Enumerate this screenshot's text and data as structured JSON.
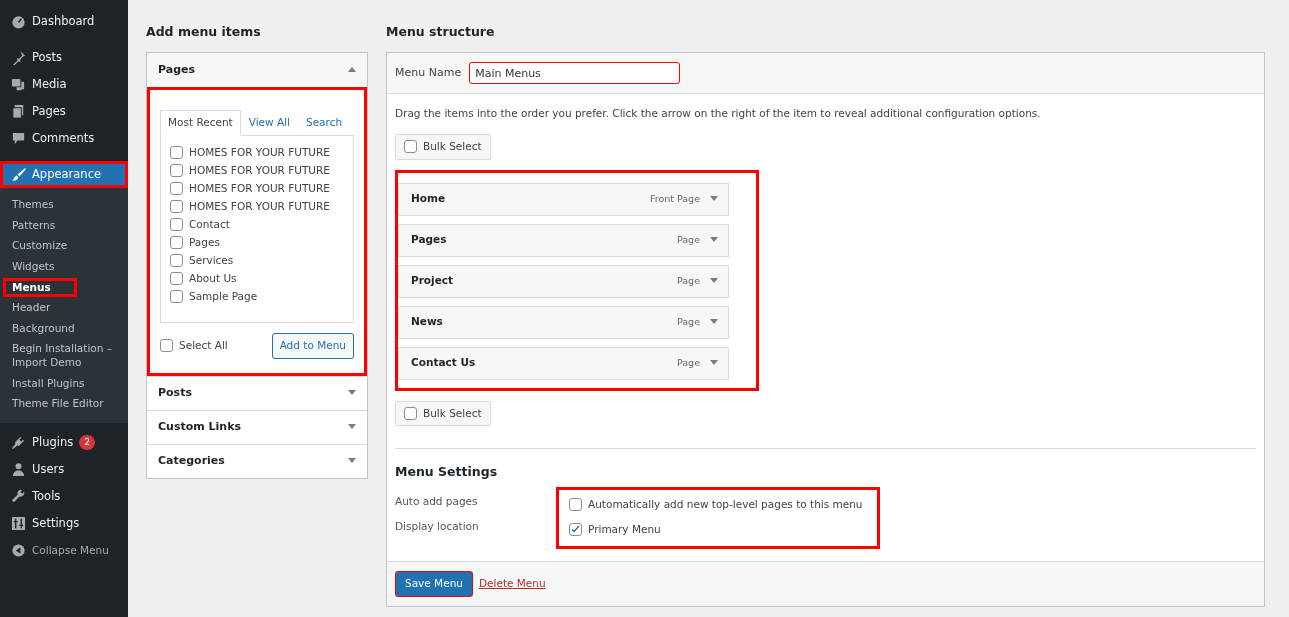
{
  "sidebar": {
    "items": [
      {
        "label": "Dashboard",
        "selected": false,
        "highlighted": false
      },
      {
        "label": "Posts",
        "selected": false,
        "highlighted": false
      },
      {
        "label": "Media",
        "selected": false,
        "highlighted": false
      },
      {
        "label": "Pages",
        "selected": false,
        "highlighted": false
      },
      {
        "label": "Comments",
        "selected": false,
        "highlighted": false
      },
      {
        "label": "Appearance",
        "selected": true,
        "highlighted": true,
        "children": [
          {
            "label": "Themes",
            "selected": false,
            "highlighted": false
          },
          {
            "label": "Patterns",
            "selected": false,
            "highlighted": false
          },
          {
            "label": "Customize",
            "selected": false,
            "highlighted": false
          },
          {
            "label": "Widgets",
            "selected": false,
            "highlighted": false
          },
          {
            "label": "Menus",
            "selected": true,
            "highlighted": true
          },
          {
            "label": "Header",
            "selected": false,
            "highlighted": false
          },
          {
            "label": "Background",
            "selected": false,
            "highlighted": false
          },
          {
            "label": "Begin Installation – Import Demo",
            "selected": false,
            "highlighted": false
          },
          {
            "label": "Install Plugins",
            "selected": false,
            "highlighted": false
          },
          {
            "label": "Theme File Editor",
            "selected": false,
            "highlighted": false
          }
        ]
      },
      {
        "label": "Plugins",
        "selected": false,
        "highlighted": false,
        "badge": "2"
      },
      {
        "label": "Users",
        "selected": false,
        "highlighted": false
      },
      {
        "label": "Tools",
        "selected": false,
        "highlighted": false
      },
      {
        "label": "Settings",
        "selected": false,
        "highlighted": false
      },
      {
        "label": "Collapse Menu",
        "selected": false,
        "highlighted": false
      }
    ]
  },
  "add_menu_items": {
    "heading": "Add menu items",
    "panels": [
      {
        "title": "Pages",
        "expanded": true,
        "highlighted": true,
        "tabs": [
          {
            "label": "Most Recent",
            "selected": true
          },
          {
            "label": "View All",
            "selected": false
          },
          {
            "label": "Search",
            "selected": false
          }
        ],
        "items": [
          {
            "label": "HOMES FOR YOUR FUTURE",
            "checked": false
          },
          {
            "label": "HOMES FOR YOUR FUTURE",
            "checked": false
          },
          {
            "label": "HOMES FOR YOUR FUTURE",
            "checked": false
          },
          {
            "label": "HOMES FOR YOUR FUTURE",
            "checked": false
          },
          {
            "label": "Contact",
            "checked": false
          },
          {
            "label": "Pages",
            "checked": false
          },
          {
            "label": "Services",
            "checked": false
          },
          {
            "label": "About Us",
            "checked": false
          },
          {
            "label": "Sample Page",
            "checked": false
          }
        ],
        "select_all": {
          "label": "Select All",
          "checked": false
        },
        "button": "Add to Menu"
      },
      {
        "title": "Posts",
        "expanded": false
      },
      {
        "title": "Custom Links",
        "expanded": false
      },
      {
        "title": "Categories",
        "expanded": false
      }
    ]
  },
  "menu_structure": {
    "heading": "Menu structure",
    "menu_name_label": "Menu Name",
    "menu_name": {
      "value": "Main Menus",
      "highlighted": true
    },
    "instructions": "Drag the items into the order you prefer. Click the arrow on the right of the item to reveal additional configuration options.",
    "bulk_select_top": {
      "label": "Bulk Select",
      "checked": false
    },
    "items_highlighted": true,
    "items": [
      {
        "title": "Home",
        "type": "Front Page"
      },
      {
        "title": "Pages",
        "type": "Page"
      },
      {
        "title": "Project",
        "type": "Page"
      },
      {
        "title": "News",
        "type": "Page"
      },
      {
        "title": "Contact Us",
        "type": "Page"
      }
    ],
    "bulk_select_bottom": {
      "label": "Bulk Select",
      "checked": false
    },
    "settings": {
      "heading": "Menu Settings",
      "highlighted": true,
      "rows": [
        {
          "label": "Auto add pages",
          "option": "Automatically add new top-level pages to this menu",
          "checked": false
        },
        {
          "label": "Display location",
          "option": "Primary Menu",
          "checked": true
        }
      ]
    },
    "save_button": {
      "label": "Save Menu",
      "highlighted": true
    },
    "delete_link": "Delete Menu"
  }
}
